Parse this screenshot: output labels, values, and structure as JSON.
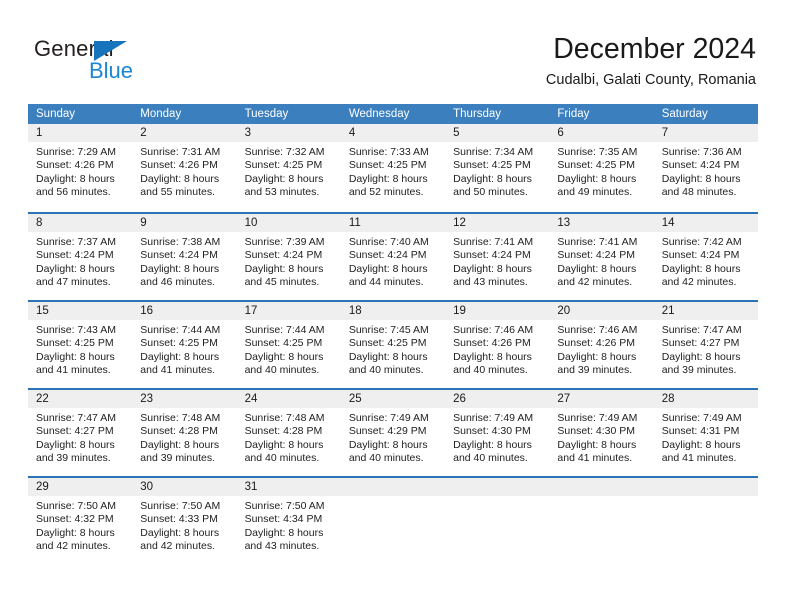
{
  "brand": {
    "name_top": "General",
    "name_bottom": "Blue",
    "color_dark": "#231f20",
    "color_blue": "#1b86d4",
    "triangle_icon": "triangle-icon"
  },
  "header": {
    "title": "December 2024",
    "subtitle": "Cudalbi, Galati County, Romania"
  },
  "theme": {
    "header_blue": "#3b7fbf",
    "row_divider_blue": "#2b74b8",
    "day_band_gray": "#efeff0"
  },
  "calendar": {
    "weekdays": [
      "Sunday",
      "Monday",
      "Tuesday",
      "Wednesday",
      "Thursday",
      "Friday",
      "Saturday"
    ],
    "weeks": [
      [
        {
          "day": "1",
          "sunrise": "Sunrise: 7:29 AM",
          "sunset": "Sunset: 4:26 PM",
          "daylight1": "Daylight: 8 hours",
          "daylight2": "and 56 minutes."
        },
        {
          "day": "2",
          "sunrise": "Sunrise: 7:31 AM",
          "sunset": "Sunset: 4:26 PM",
          "daylight1": "Daylight: 8 hours",
          "daylight2": "and 55 minutes."
        },
        {
          "day": "3",
          "sunrise": "Sunrise: 7:32 AM",
          "sunset": "Sunset: 4:25 PM",
          "daylight1": "Daylight: 8 hours",
          "daylight2": "and 53 minutes."
        },
        {
          "day": "4",
          "sunrise": "Sunrise: 7:33 AM",
          "sunset": "Sunset: 4:25 PM",
          "daylight1": "Daylight: 8 hours",
          "daylight2": "and 52 minutes."
        },
        {
          "day": "5",
          "sunrise": "Sunrise: 7:34 AM",
          "sunset": "Sunset: 4:25 PM",
          "daylight1": "Daylight: 8 hours",
          "daylight2": "and 50 minutes."
        },
        {
          "day": "6",
          "sunrise": "Sunrise: 7:35 AM",
          "sunset": "Sunset: 4:25 PM",
          "daylight1": "Daylight: 8 hours",
          "daylight2": "and 49 minutes."
        },
        {
          "day": "7",
          "sunrise": "Sunrise: 7:36 AM",
          "sunset": "Sunset: 4:24 PM",
          "daylight1": "Daylight: 8 hours",
          "daylight2": "and 48 minutes."
        }
      ],
      [
        {
          "day": "8",
          "sunrise": "Sunrise: 7:37 AM",
          "sunset": "Sunset: 4:24 PM",
          "daylight1": "Daylight: 8 hours",
          "daylight2": "and 47 minutes."
        },
        {
          "day": "9",
          "sunrise": "Sunrise: 7:38 AM",
          "sunset": "Sunset: 4:24 PM",
          "daylight1": "Daylight: 8 hours",
          "daylight2": "and 46 minutes."
        },
        {
          "day": "10",
          "sunrise": "Sunrise: 7:39 AM",
          "sunset": "Sunset: 4:24 PM",
          "daylight1": "Daylight: 8 hours",
          "daylight2": "and 45 minutes."
        },
        {
          "day": "11",
          "sunrise": "Sunrise: 7:40 AM",
          "sunset": "Sunset: 4:24 PM",
          "daylight1": "Daylight: 8 hours",
          "daylight2": "and 44 minutes."
        },
        {
          "day": "12",
          "sunrise": "Sunrise: 7:41 AM",
          "sunset": "Sunset: 4:24 PM",
          "daylight1": "Daylight: 8 hours",
          "daylight2": "and 43 minutes."
        },
        {
          "day": "13",
          "sunrise": "Sunrise: 7:41 AM",
          "sunset": "Sunset: 4:24 PM",
          "daylight1": "Daylight: 8 hours",
          "daylight2": "and 42 minutes."
        },
        {
          "day": "14",
          "sunrise": "Sunrise: 7:42 AM",
          "sunset": "Sunset: 4:24 PM",
          "daylight1": "Daylight: 8 hours",
          "daylight2": "and 42 minutes."
        }
      ],
      [
        {
          "day": "15",
          "sunrise": "Sunrise: 7:43 AM",
          "sunset": "Sunset: 4:25 PM",
          "daylight1": "Daylight: 8 hours",
          "daylight2": "and 41 minutes."
        },
        {
          "day": "16",
          "sunrise": "Sunrise: 7:44 AM",
          "sunset": "Sunset: 4:25 PM",
          "daylight1": "Daylight: 8 hours",
          "daylight2": "and 41 minutes."
        },
        {
          "day": "17",
          "sunrise": "Sunrise: 7:44 AM",
          "sunset": "Sunset: 4:25 PM",
          "daylight1": "Daylight: 8 hours",
          "daylight2": "and 40 minutes."
        },
        {
          "day": "18",
          "sunrise": "Sunrise: 7:45 AM",
          "sunset": "Sunset: 4:25 PM",
          "daylight1": "Daylight: 8 hours",
          "daylight2": "and 40 minutes."
        },
        {
          "day": "19",
          "sunrise": "Sunrise: 7:46 AM",
          "sunset": "Sunset: 4:26 PM",
          "daylight1": "Daylight: 8 hours",
          "daylight2": "and 40 minutes."
        },
        {
          "day": "20",
          "sunrise": "Sunrise: 7:46 AM",
          "sunset": "Sunset: 4:26 PM",
          "daylight1": "Daylight: 8 hours",
          "daylight2": "and 39 minutes."
        },
        {
          "day": "21",
          "sunrise": "Sunrise: 7:47 AM",
          "sunset": "Sunset: 4:27 PM",
          "daylight1": "Daylight: 8 hours",
          "daylight2": "and 39 minutes."
        }
      ],
      [
        {
          "day": "22",
          "sunrise": "Sunrise: 7:47 AM",
          "sunset": "Sunset: 4:27 PM",
          "daylight1": "Daylight: 8 hours",
          "daylight2": "and 39 minutes."
        },
        {
          "day": "23",
          "sunrise": "Sunrise: 7:48 AM",
          "sunset": "Sunset: 4:28 PM",
          "daylight1": "Daylight: 8 hours",
          "daylight2": "and 39 minutes."
        },
        {
          "day": "24",
          "sunrise": "Sunrise: 7:48 AM",
          "sunset": "Sunset: 4:28 PM",
          "daylight1": "Daylight: 8 hours",
          "daylight2": "and 40 minutes."
        },
        {
          "day": "25",
          "sunrise": "Sunrise: 7:49 AM",
          "sunset": "Sunset: 4:29 PM",
          "daylight1": "Daylight: 8 hours",
          "daylight2": "and 40 minutes."
        },
        {
          "day": "26",
          "sunrise": "Sunrise: 7:49 AM",
          "sunset": "Sunset: 4:30 PM",
          "daylight1": "Daylight: 8 hours",
          "daylight2": "and 40 minutes."
        },
        {
          "day": "27",
          "sunrise": "Sunrise: 7:49 AM",
          "sunset": "Sunset: 4:30 PM",
          "daylight1": "Daylight: 8 hours",
          "daylight2": "and 41 minutes."
        },
        {
          "day": "28",
          "sunrise": "Sunrise: 7:49 AM",
          "sunset": "Sunset: 4:31 PM",
          "daylight1": "Daylight: 8 hours",
          "daylight2": "and 41 minutes."
        }
      ],
      [
        {
          "day": "29",
          "sunrise": "Sunrise: 7:50 AM",
          "sunset": "Sunset: 4:32 PM",
          "daylight1": "Daylight: 8 hours",
          "daylight2": "and 42 minutes."
        },
        {
          "day": "30",
          "sunrise": "Sunrise: 7:50 AM",
          "sunset": "Sunset: 4:33 PM",
          "daylight1": "Daylight: 8 hours",
          "daylight2": "and 42 minutes."
        },
        {
          "day": "31",
          "sunrise": "Sunrise: 7:50 AM",
          "sunset": "Sunset: 4:34 PM",
          "daylight1": "Daylight: 8 hours",
          "daylight2": "and 43 minutes."
        },
        {
          "day": "",
          "sunrise": "",
          "sunset": "",
          "daylight1": "",
          "daylight2": ""
        },
        {
          "day": "",
          "sunrise": "",
          "sunset": "",
          "daylight1": "",
          "daylight2": ""
        },
        {
          "day": "",
          "sunrise": "",
          "sunset": "",
          "daylight1": "",
          "daylight2": ""
        },
        {
          "day": "",
          "sunrise": "",
          "sunset": "",
          "daylight1": "",
          "daylight2": ""
        }
      ]
    ]
  }
}
